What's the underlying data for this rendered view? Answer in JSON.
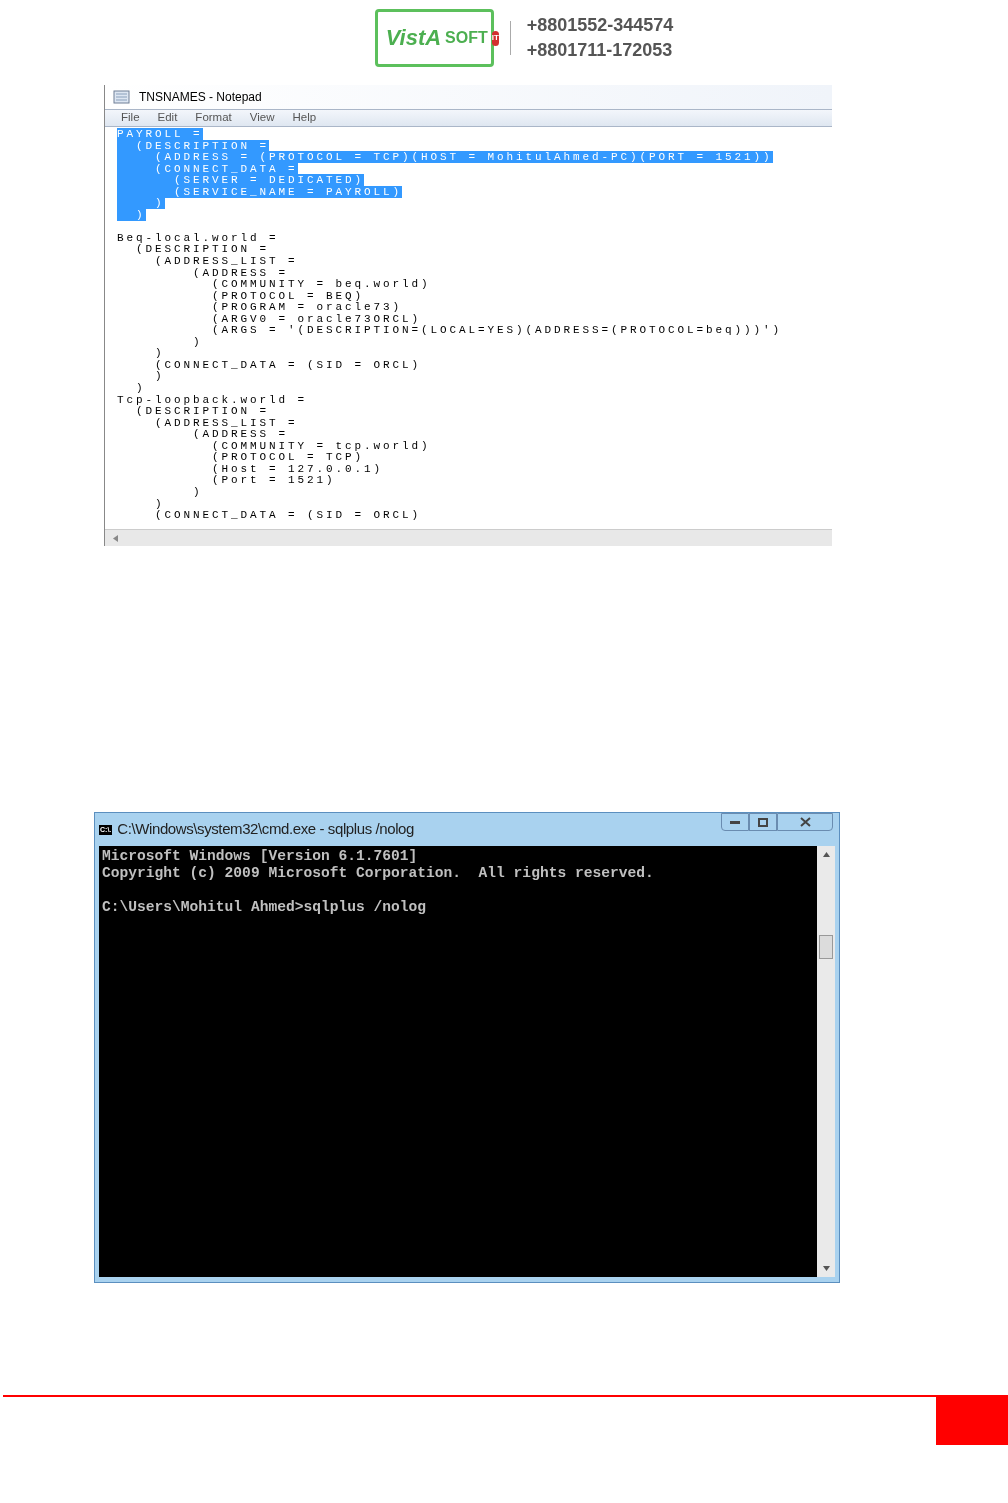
{
  "header": {
    "logo": {
      "word": "VistA",
      "soft": "SOFT",
      "badge": "IT"
    },
    "phones": [
      "+8801552-344574",
      "+8801711-172053"
    ]
  },
  "notepad": {
    "title": "TNSNAMES - Notepad",
    "menu": [
      "File",
      "Edit",
      "Format",
      "View",
      "Help"
    ],
    "lines": [
      {
        "text": "PAYROLL =",
        "selected": true
      },
      {
        "text": "  (DESCRIPTION =",
        "selected": true
      },
      {
        "text": "    (ADDRESS = (PROTOCOL = TCP)(HOST = MohitulAhmed-PC)(PORT = 1521))",
        "selected": true
      },
      {
        "text": "    (CONNECT_DATA =",
        "selected": true
      },
      {
        "text": "      (SERVER = DEDICATED)",
        "selected": true
      },
      {
        "text": "      (SERVICE_NAME = PAYROLL)",
        "selected": true
      },
      {
        "text": "    )",
        "selected": true
      },
      {
        "text": "  )",
        "selected": true
      },
      {
        "text": "Beq-local.world =",
        "selected": false
      },
      {
        "text": "  (DESCRIPTION =",
        "selected": false
      },
      {
        "text": "    (ADDRESS_LIST =",
        "selected": false
      },
      {
        "text": "        (ADDRESS =",
        "selected": false
      },
      {
        "text": "          (COMMUNITY = beq.world)",
        "selected": false
      },
      {
        "text": "          (PROTOCOL = BEQ)",
        "selected": false
      },
      {
        "text": "          (PROGRAM = oracle73)",
        "selected": false
      },
      {
        "text": "          (ARGV0 = oracle73ORCL)",
        "selected": false
      },
      {
        "text": "          (ARGS = '(DESCRIPTION=(LOCAL=YES)(ADDRESS=(PROTOCOL=beq)))')",
        "selected": false
      },
      {
        "text": "        )",
        "selected": false
      },
      {
        "text": "    )",
        "selected": false
      },
      {
        "text": "    (CONNECT_DATA = (SID = ORCL)",
        "selected": false
      },
      {
        "text": "    )",
        "selected": false
      },
      {
        "text": "  )",
        "selected": false
      },
      {
        "text": "Tcp-loopback.world =",
        "selected": false
      },
      {
        "text": "  (DESCRIPTION =",
        "selected": false
      },
      {
        "text": "    (ADDRESS_LIST =",
        "selected": false
      },
      {
        "text": "        (ADDRESS =",
        "selected": false
      },
      {
        "text": "          (COMMUNITY = tcp.world)",
        "selected": false
      },
      {
        "text": "          (PROTOCOL = TCP)",
        "selected": false
      },
      {
        "text": "          (Host = 127.0.0.1)",
        "selected": false
      },
      {
        "text": "          (Port = 1521)",
        "selected": false
      },
      {
        "text": "        )",
        "selected": false
      },
      {
        "text": "    )",
        "selected": false
      },
      {
        "text": "    (CONNECT_DATA = (SID = ORCL)",
        "selected": false
      }
    ]
  },
  "console": {
    "title": "C:\\Windows\\system32\\cmd.exe - sqlplus  /nolog",
    "icon": "C:\\.",
    "lines": [
      {
        "kind": "text",
        "text": "Microsoft Windows [Version 6.1.7601]"
      },
      {
        "kind": "text",
        "text": "Copyright (c) 2009 Microsoft Corporation.  All rights reserved."
      },
      {
        "kind": "blank"
      },
      {
        "kind": "text",
        "text": "C:\\Users\\Mohitul Ahmed>sqlplus /nolog"
      }
    ]
  }
}
